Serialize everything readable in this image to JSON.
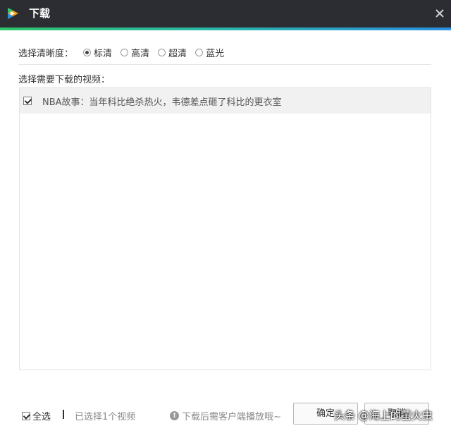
{
  "titlebar": {
    "title": "下载",
    "logo_icon": "tencent-video-play-icon",
    "close_icon": "close-icon"
  },
  "quality": {
    "label": "选择清晰度：",
    "options": [
      {
        "label": "标清",
        "selected": true
      },
      {
        "label": "高清",
        "selected": false
      },
      {
        "label": "超清",
        "selected": false
      },
      {
        "label": "蓝光",
        "selected": false
      }
    ]
  },
  "videos": {
    "label": "选择需要下载的视频：",
    "items": [
      {
        "title": "NBA故事：当年科比绝杀热火，韦德差点砸了科比的更衣室",
        "checked": true
      }
    ]
  },
  "footer": {
    "select_all_label": "全选",
    "selected_count": "已选择1个视频",
    "hint": "下载后需客户端播放哦~",
    "confirm_label": "确定",
    "cancel_label": "取消"
  },
  "watermark": "头条 @海上的萤火虫",
  "colors": {
    "titlebar_bg": "#2b2d33",
    "accent_gradient": [
      "#2fc36a",
      "#29b8a6",
      "#2a8fe0"
    ]
  }
}
